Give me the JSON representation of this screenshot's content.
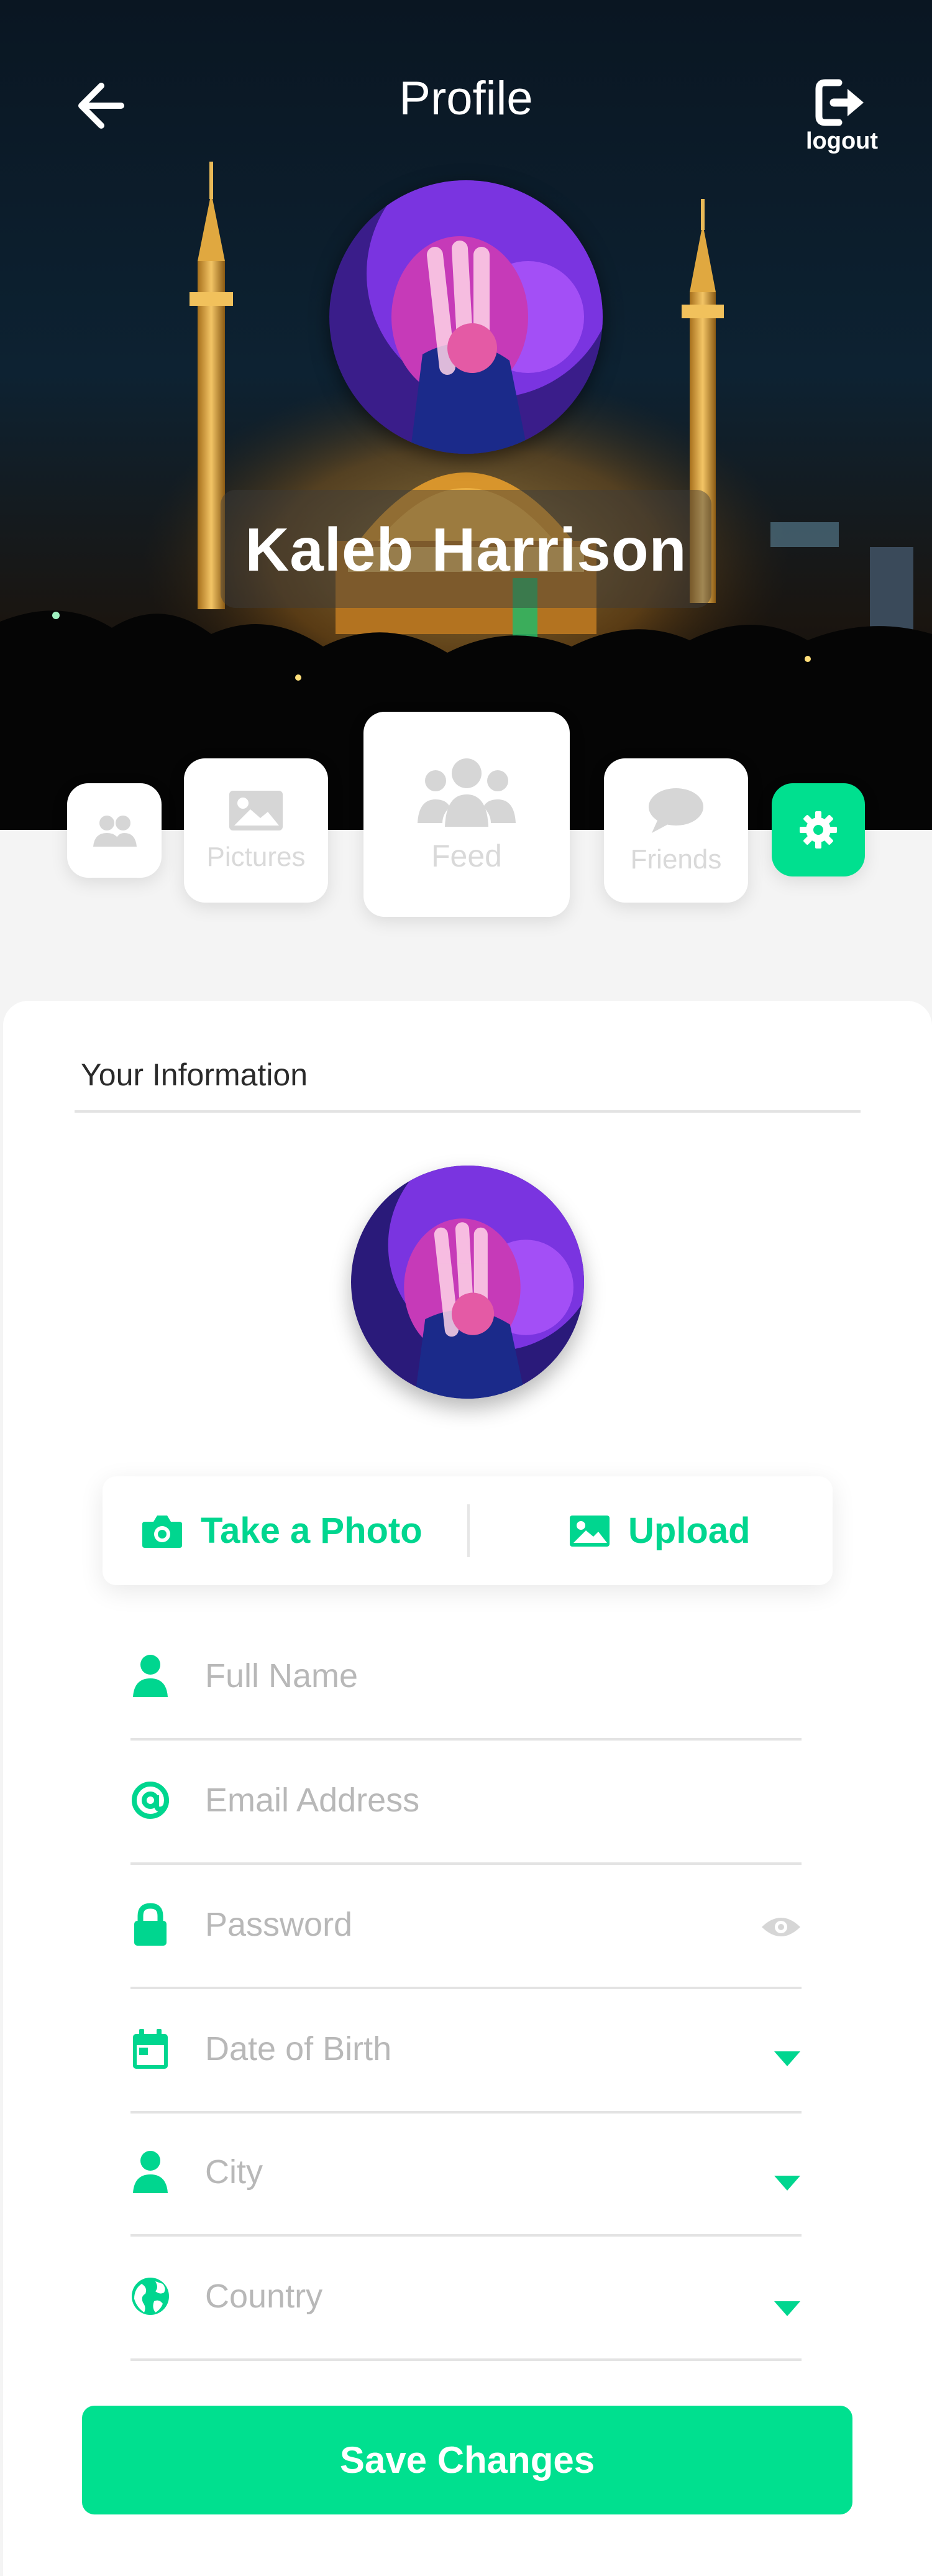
{
  "header": {
    "title": "Profile",
    "logout_label": "logout"
  },
  "profile": {
    "name": "Kaleb Harrison"
  },
  "tabs": [
    {
      "label": "",
      "icon": "users-icon"
    },
    {
      "label": "Pictures",
      "icon": "image-icon"
    },
    {
      "label": "Feed",
      "icon": "group-icon"
    },
    {
      "label": "Friends",
      "icon": "chat-icon"
    },
    {
      "label": "",
      "icon": "gear-icon"
    }
  ],
  "section": {
    "title": "Your Information"
  },
  "photo_actions": {
    "take_photo": "Take a Photo",
    "upload": "Upload"
  },
  "fields": [
    {
      "placeholder": "Full Name",
      "icon": "user-icon"
    },
    {
      "placeholder": "Email Address",
      "icon": "at-icon"
    },
    {
      "placeholder": "Password",
      "icon": "lock-icon"
    },
    {
      "placeholder": "Date of Birth",
      "icon": "calendar-icon"
    },
    {
      "placeholder": "City",
      "icon": "user-icon"
    },
    {
      "placeholder": "Country",
      "icon": "globe-icon"
    }
  ],
  "save_label": "Save Changes",
  "colors": {
    "accent": "#00e08f",
    "placeholder": "#b8b8b8",
    "divider": "#e3e3e3"
  }
}
